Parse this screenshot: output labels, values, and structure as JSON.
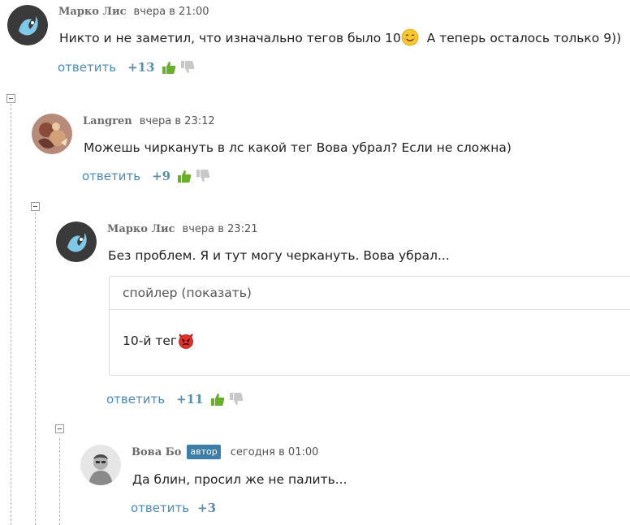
{
  "comments": [
    {
      "author": "Марко Лис",
      "time": "вчера в 21:00",
      "text": "Никто и не заметил, что изначально тегов было 10",
      "emoji": "smiling-face-emoji",
      "text_after": "А теперь осталось только 9))",
      "reply": "ответить",
      "rating": "+13"
    },
    {
      "author": "Langren",
      "time": "вчера в 23:12",
      "text": "Можешь чиркануть в лс какой тег Вова убрал? Если не сложна)",
      "reply": "ответить",
      "rating": "+9"
    },
    {
      "author": "Марко Лис",
      "time": "вчера в 23:21",
      "text": "Без проблем. Я и тут могу черкануть. Вова убрал...",
      "spoiler": {
        "toggle": "спойлер (показать)",
        "content": "10-й тег",
        "emoji": "angry-devil-emoji"
      },
      "reply": "ответить",
      "rating": "+11"
    },
    {
      "author": "Вова Бо",
      "badge": "автор",
      "time": "сегодня в 01:00",
      "text": "Да блин, просил же не палить...",
      "reply": "ответить",
      "rating": "+3"
    }
  ],
  "colors": {
    "reply_link": "#4a8ab8",
    "rating": "#5a8fa8",
    "thumb_up": "#6aae2e",
    "thumb_down": "#c8c8c8",
    "author_badge": "#3d7ea8"
  }
}
